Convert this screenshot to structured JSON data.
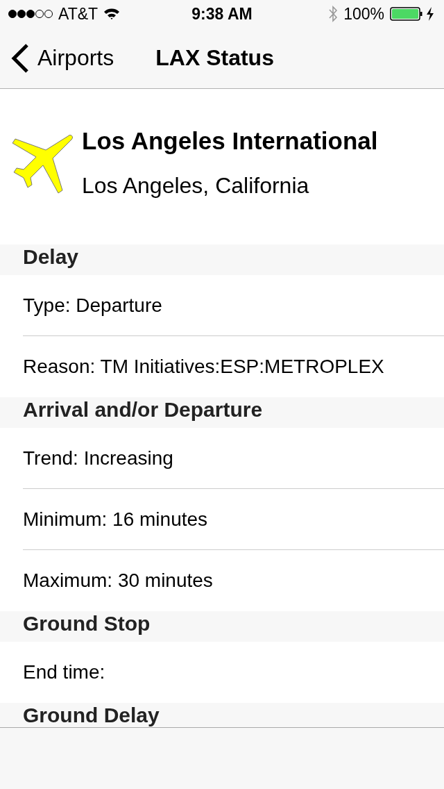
{
  "status_bar": {
    "carrier": "AT&T",
    "time": "9:38 AM",
    "battery": "100%"
  },
  "nav": {
    "back": "Airports",
    "title": "LAX Status"
  },
  "airport": {
    "name": "Los Angeles International",
    "location": "Los Angeles, California"
  },
  "sections": [
    {
      "title": "Delay",
      "rows": [
        "Type: Departure",
        "Reason: TM Initiatives:ESP:METROPLEX"
      ]
    },
    {
      "title": "Arrival and/or Departure",
      "rows": [
        "Trend: Increasing",
        "Minimum: 16 minutes",
        "Maximum: 30 minutes"
      ]
    },
    {
      "title": "Ground Stop",
      "rows": [
        "End time:"
      ]
    },
    {
      "title": "Ground Delay"
    }
  ]
}
